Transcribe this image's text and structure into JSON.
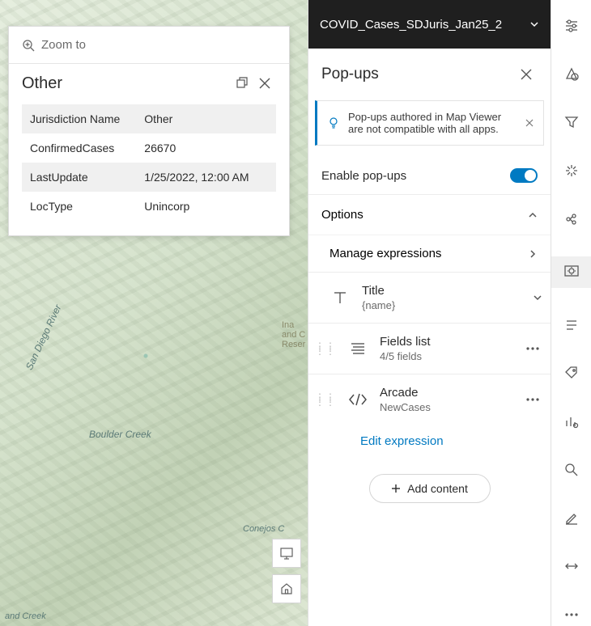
{
  "popup": {
    "zoom_label": "Zoom to",
    "title": "Other",
    "rows": [
      {
        "k": "Jurisdiction Name",
        "v": "Other"
      },
      {
        "k": "ConfirmedCases",
        "v": "26670"
      },
      {
        "k": "LastUpdate",
        "v": "1/25/2022, 12:00 AM"
      },
      {
        "k": "LocType",
        "v": "Unincorp"
      }
    ]
  },
  "map_labels": {
    "river": "San Diego River",
    "creek": "Boulder Creek",
    "res": "Ina\nand C\nReser",
    "creek2": "and Creek",
    "creek3": "Conejos C"
  },
  "layer_title": "COVID_Cases_SDJuris_Jan25_2",
  "panel": {
    "title": "Pop-ups",
    "notice": "Pop-ups authored in Map Viewer are not compatible with all apps.",
    "enable_label": "Enable pop-ups",
    "options_label": "Options",
    "manage_label": "Manage expressions",
    "cards": {
      "title": {
        "label": "Title",
        "sub": "{name}"
      },
      "fields": {
        "label": "Fields list",
        "sub": "4/5 fields"
      },
      "arcade": {
        "label": "Arcade",
        "sub": "NewCases"
      }
    },
    "edit_link": "Edit expression",
    "add_label": "Add content"
  }
}
